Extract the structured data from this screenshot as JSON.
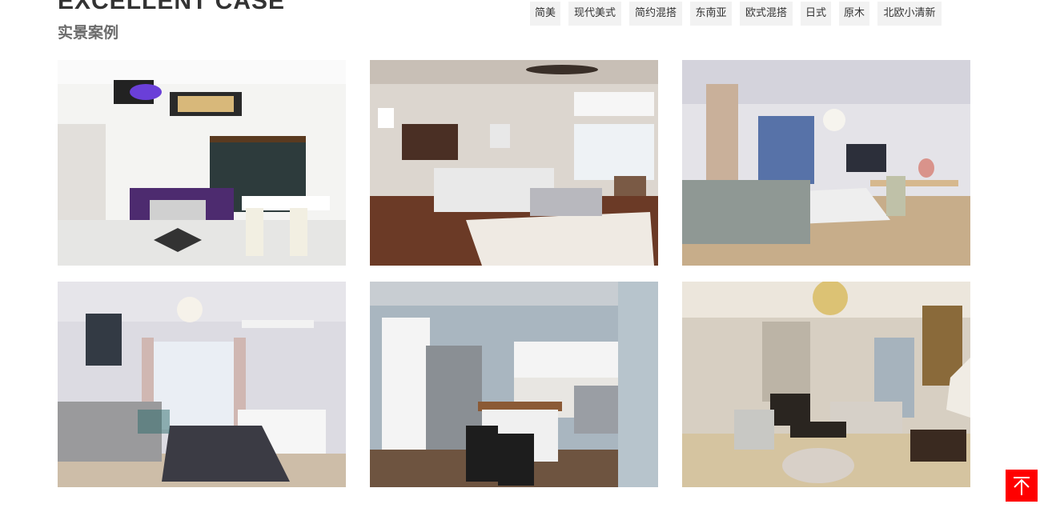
{
  "section": {
    "title_en": "EXCELLENT CASE",
    "title_cn": "实景案例"
  },
  "filters": [
    "简美",
    "现代美式",
    "简约混搭",
    "东南亚",
    "欧式混搭",
    "日式",
    "原木",
    "北欧小清新"
  ],
  "cases": [
    {
      "scene": "living-dining room with purple sofa and white dining chairs"
    },
    {
      "scene": "open kitchen and living room with white sectional sofa"
    },
    {
      "scene": "bright living room with grey sofa and wooden dining table"
    },
    {
      "scene": "living room with grey sofa and patterned rug"
    },
    {
      "scene": "kitchen with stainless fridge and wooden island"
    },
    {
      "scene": "classical european living room with chandelier"
    }
  ],
  "colors": {
    "accent": "#ff0000",
    "tag_bg": "#f2f2f2",
    "title": "#333333",
    "subtitle": "#6b6b6b"
  },
  "back_to_top": {
    "icon": "arrow-up-icon"
  }
}
